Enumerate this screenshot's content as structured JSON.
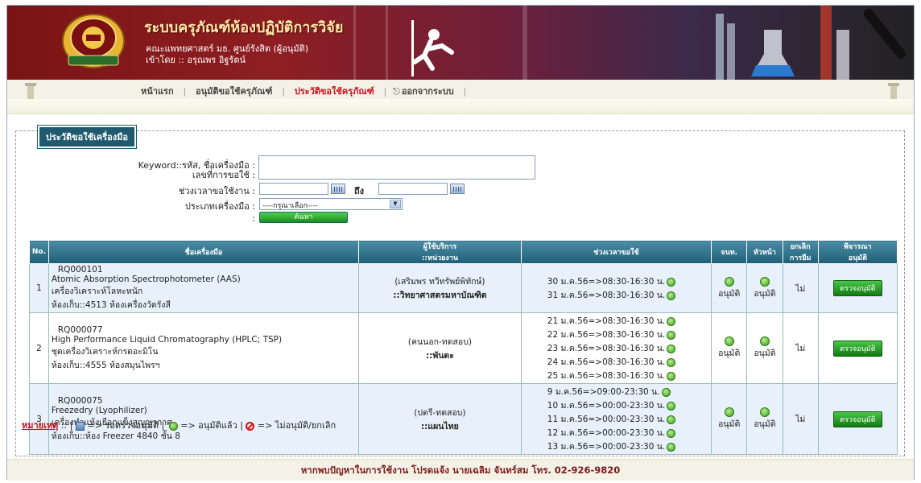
{
  "header": {
    "title": "ระบบครุภัณฑ์ห้องปฏิบัติการวิจัย",
    "faculty": "คณะแพทยศาสตร์ มธ. ศูนย์รังสิต (ผู้อนุมัติ)",
    "login": "เข้าโดย :: อรุณพร อิฐรัตน์"
  },
  "nav": {
    "items": [
      "หน้าแรก",
      "อนุมัติขอใช้ครุภัณฑ์",
      "ประวัติขอใช้ครุภัณฑ์",
      "ออกจากระบบ"
    ],
    "active_index": 2
  },
  "section": {
    "legend": "ประวัติขอใช้เครื่องมือ"
  },
  "search": {
    "keyword_label": "Keyword::รหัส, ชื่อเครื่องมือ :",
    "keyword_label2": "เลขที่การขอใช้ :",
    "period_label": "ช่วงเวลาขอใช้งาน :",
    "to_label": "ถึง",
    "type_label": "ประเภทเครื่องมือ :",
    "type_selected": "----กรุณาเลือก----",
    "colon": ":",
    "search_button": "ค้นหา"
  },
  "table": {
    "headers": [
      "No.",
      "ชื่อเครื่องมือ",
      "ผู้ใช้บริการ",
      "::หน่วยงาน",
      "ช่วงเวลาขอใช้",
      "จนท.",
      "หัวหน้า",
      "ยกเลิก",
      "การยืม",
      "พิจารณา",
      "อนุมัติ"
    ],
    "rows": [
      {
        "no": "1",
        "code": "RQ000101",
        "name_en": "Atomic Absorption Spectrophotometer (AAS)",
        "name_th": "เครื่องวิเคราะห์โลหะหนัก",
        "room": "ห้องเก็บ::4513 ห้องเครื่องวัดรังสี",
        "user": "(เสริมพร ทวีทรัพย์พิทักษ์)",
        "dept": "::วิทยาศาสตรมหาบัณฑิต",
        "times": [
          "30 ม.ค.56=>08:30-16:30 น.",
          "31 ม.ค.56=>08:30-16:30 น."
        ],
        "staff": "อนุมัติ",
        "head": "อนุมัติ",
        "cancel": "ไม่",
        "action": "ตรวจอนุมัติ"
      },
      {
        "no": "2",
        "code": "RQ000077",
        "name_en": "High Performance Liquid Chromatography (HPLC; TSP)",
        "name_th": "ชุดเครื่องวิเคราะห์กรดอะมิโน",
        "room": "ห้องเก็บ::4555 ห้องสมุนไพรฯ",
        "user": "(คนนอก-ทดสอบ)",
        "dept": "::พันตะ",
        "times": [
          "21 ม.ค.56=>08:30-16:30 น.",
          "22 ม.ค.56=>08:30-16:30 น.",
          "23 ม.ค.56=>08:30-16:30 น.",
          "24 ม.ค.56=>08:30-16:30 น.",
          "25 ม.ค.56=>08:30-16:30 น."
        ],
        "staff": "อนุมัติ",
        "head": "อนุมัติ",
        "cancel": "ไม่",
        "action": "ตรวจอนุมัติ"
      },
      {
        "no": "3",
        "code": "RQ000075",
        "name_en": "Freezedry (Lyophilizer)",
        "name_th": "เครื่องทำแห้งเยือกแข็งสูญญากาศ",
        "room": "ห้องเก็บ::ห้อง Freezer 4840 ชั้น 8",
        "user": "(ปตรี-ทดสอบ)",
        "dept": "::แผนไทย",
        "times": [
          "9 ม.ค.56=>09:00-23:30 น.",
          "10 ม.ค.56=>00:00-23:30 น.",
          "11 ม.ค.56=>00:00-23:30 น.",
          "12 ม.ค.56=>00:00-23:30 น.",
          "13 ม.ค.56=>00:00-23:30 น."
        ],
        "staff": "อนุมัติ",
        "head": "อนุมัติ",
        "cancel": "ไม่",
        "action": "ตรวจอนุมัติ"
      }
    ]
  },
  "legend_note": {
    "label": "หมายเหตุ",
    "sep": ":: |",
    "pending": "=> รอตรวจอนุมัติ |",
    "approved": "=> อนุมัติแล้ว |",
    "rejected": "=> ไม่อนุมัติ/ยกเลิก"
  },
  "footer": {
    "text": "หากพบปัญหาในการใช้งาน โปรดแจ้ง นายเฉลิม จันทร์สม โทร. 02-926-9820"
  },
  "colors": {
    "banner": "#8e1e22",
    "header_row": "#1e5f78",
    "active_nav": "#d01020",
    "button": "#1c8e1c"
  }
}
